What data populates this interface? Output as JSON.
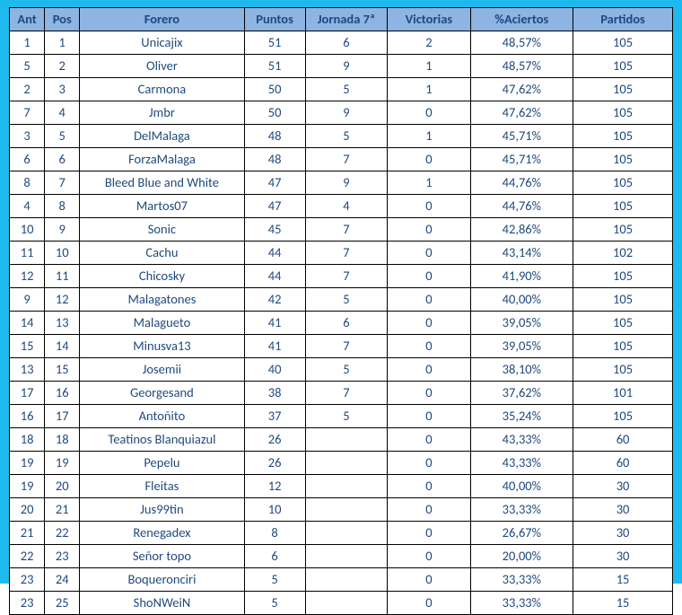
{
  "headers": {
    "ant": "Ant",
    "pos": "Pos",
    "forero": "Forero",
    "puntos": "Puntos",
    "jornada": "Jornada 7ª",
    "victorias": "Victorias",
    "aciertos": "%Aciertos",
    "partidos": "Partidos"
  },
  "rows": [
    {
      "ant": "1",
      "pos": "1",
      "forero": "Unicajix",
      "puntos": "51",
      "jornada": "6",
      "victorias": "2",
      "aciertos": "48,57%",
      "partidos": "105"
    },
    {
      "ant": "5",
      "pos": "2",
      "forero": "Oliver",
      "puntos": "51",
      "jornada": "9",
      "victorias": "1",
      "aciertos": "48,57%",
      "partidos": "105"
    },
    {
      "ant": "2",
      "pos": "3",
      "forero": "Carmona",
      "puntos": "50",
      "jornada": "5",
      "victorias": "1",
      "aciertos": "47,62%",
      "partidos": "105"
    },
    {
      "ant": "7",
      "pos": "4",
      "forero": "Jmbr",
      "puntos": "50",
      "jornada": "9",
      "victorias": "0",
      "aciertos": "47,62%",
      "partidos": "105"
    },
    {
      "ant": "3",
      "pos": "5",
      "forero": "DelMalaga",
      "puntos": "48",
      "jornada": "5",
      "victorias": "1",
      "aciertos": "45,71%",
      "partidos": "105"
    },
    {
      "ant": "6",
      "pos": "6",
      "forero": "ForzaMalaga",
      "puntos": "48",
      "jornada": "7",
      "victorias": "0",
      "aciertos": "45,71%",
      "partidos": "105"
    },
    {
      "ant": "8",
      "pos": "7",
      "forero": "Bleed Blue and White",
      "puntos": "47",
      "jornada": "9",
      "victorias": "1",
      "aciertos": "44,76%",
      "partidos": "105"
    },
    {
      "ant": "4",
      "pos": "8",
      "forero": "Martos07",
      "puntos": "47",
      "jornada": "4",
      "victorias": "0",
      "aciertos": "44,76%",
      "partidos": "105"
    },
    {
      "ant": "10",
      "pos": "9",
      "forero": "Sonic",
      "puntos": "45",
      "jornada": "7",
      "victorias": "0",
      "aciertos": "42,86%",
      "partidos": "105"
    },
    {
      "ant": "11",
      "pos": "10",
      "forero": "Cachu",
      "puntos": "44",
      "jornada": "7",
      "victorias": "0",
      "aciertos": "43,14%",
      "partidos": "102"
    },
    {
      "ant": "12",
      "pos": "11",
      "forero": "Chicosky",
      "puntos": "44",
      "jornada": "7",
      "victorias": "0",
      "aciertos": "41,90%",
      "partidos": "105"
    },
    {
      "ant": "9",
      "pos": "12",
      "forero": "Malagatones",
      "puntos": "42",
      "jornada": "5",
      "victorias": "0",
      "aciertos": "40,00%",
      "partidos": "105"
    },
    {
      "ant": "14",
      "pos": "13",
      "forero": "Malagueto",
      "puntos": "41",
      "jornada": "6",
      "victorias": "0",
      "aciertos": "39,05%",
      "partidos": "105"
    },
    {
      "ant": "15",
      "pos": "14",
      "forero": "Minusva13",
      "puntos": "41",
      "jornada": "7",
      "victorias": "0",
      "aciertos": "39,05%",
      "partidos": "105"
    },
    {
      "ant": "13",
      "pos": "15",
      "forero": "Josemii",
      "puntos": "40",
      "jornada": "5",
      "victorias": "0",
      "aciertos": "38,10%",
      "partidos": "105"
    },
    {
      "ant": "17",
      "pos": "16",
      "forero": "Georgesand",
      "puntos": "38",
      "jornada": "7",
      "victorias": "0",
      "aciertos": "37,62%",
      "partidos": "101"
    },
    {
      "ant": "16",
      "pos": "17",
      "forero": "Antoñito",
      "puntos": "37",
      "jornada": "5",
      "victorias": "0",
      "aciertos": "35,24%",
      "partidos": "105"
    },
    {
      "ant": "18",
      "pos": "18",
      "forero": "Teatinos Blanquiazul",
      "puntos": "26",
      "jornada": "",
      "victorias": "0",
      "aciertos": "43,33%",
      "partidos": "60"
    },
    {
      "ant": "19",
      "pos": "19",
      "forero": "Pepelu",
      "puntos": "26",
      "jornada": "",
      "victorias": "0",
      "aciertos": "43,33%",
      "partidos": "60"
    },
    {
      "ant": "19",
      "pos": "20",
      "forero": "Fleitas",
      "puntos": "12",
      "jornada": "",
      "victorias": "0",
      "aciertos": "40,00%",
      "partidos": "30"
    },
    {
      "ant": "20",
      "pos": "21",
      "forero": "Jus99tin",
      "puntos": "10",
      "jornada": "",
      "victorias": "0",
      "aciertos": "33,33%",
      "partidos": "30"
    },
    {
      "ant": "21",
      "pos": "22",
      "forero": "Renegadex",
      "puntos": "8",
      "jornada": "",
      "victorias": "0",
      "aciertos": "26,67%",
      "partidos": "30"
    },
    {
      "ant": "22",
      "pos": "23",
      "forero": "Señor topo",
      "puntos": "6",
      "jornada": "",
      "victorias": "0",
      "aciertos": "20,00%",
      "partidos": "30"
    },
    {
      "ant": "23",
      "pos": "24",
      "forero": "Boqueronciri",
      "puntos": "5",
      "jornada": "",
      "victorias": "0",
      "aciertos": "33,33%",
      "partidos": "15"
    },
    {
      "ant": "23",
      "pos": "25",
      "forero": "ShoNWeiN",
      "puntos": "5",
      "jornada": "",
      "victorias": "0",
      "aciertos": "33,33%",
      "partidos": "15"
    }
  ]
}
